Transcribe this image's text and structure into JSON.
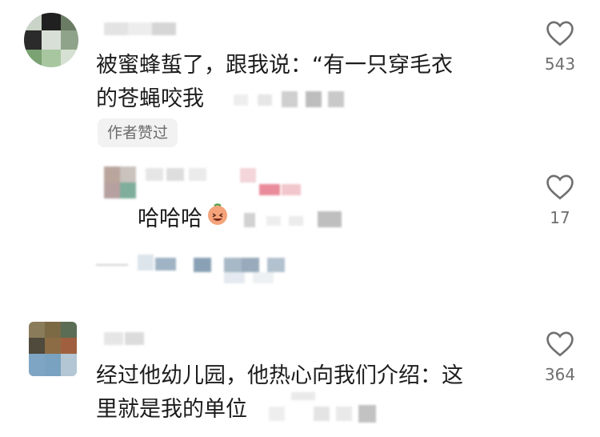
{
  "comments": [
    {
      "text_line1": "被蜜蜂蜇了，跟我说：“有一只穿毛衣",
      "text_line2": "的苍蝇咬我",
      "badge": "作者赞过",
      "likes": "543"
    },
    {
      "text": "哈哈哈",
      "likes": "17"
    },
    {
      "text_line1": "经过他幼儿园，他热心向我们介绍：这",
      "text_line2": "里就是我的单位",
      "likes": "364"
    }
  ],
  "icons": {
    "like": "heart-outline-icon",
    "emoji": "laughing-face-emoji"
  },
  "colors": {
    "text": "#1c1c1c",
    "muted": "#6f6f6f",
    "badge_bg": "#f2f2f2"
  }
}
